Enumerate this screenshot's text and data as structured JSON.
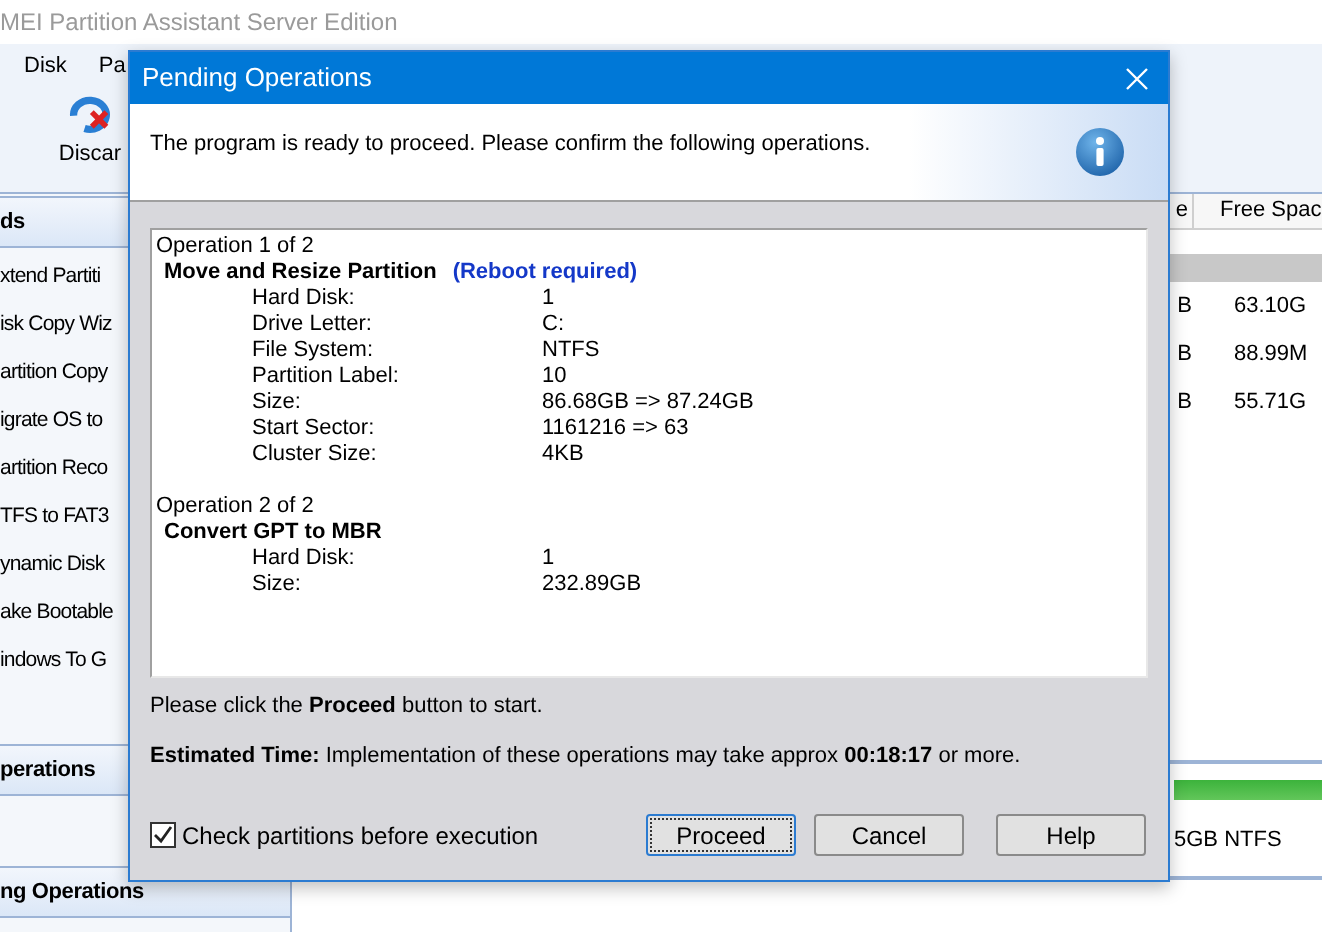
{
  "app": {
    "title": "MEI Partition Assistant Server Edition",
    "menu": [
      "Disk",
      "Pa"
    ],
    "toolbar": [
      {
        "label": "Discar"
      }
    ],
    "sidebar": {
      "sections": [
        {
          "title": "ds",
          "items": [
            "xtend Partiti",
            "isk Copy Wiz",
            "artition Copy",
            "igrate OS to",
            "artition Reco",
            "TFS to FAT3",
            "ynamic Disk",
            "ake Bootable",
            "indows To G"
          ]
        },
        {
          "title": "perations"
        },
        {
          "title": "ng Operations"
        }
      ]
    },
    "table": {
      "columns": [
        "e",
        "Free Spac"
      ],
      "rows": [
        [
          "B",
          "63.10G"
        ],
        [
          "B",
          "88.99M"
        ],
        [
          "B",
          "55.71G"
        ]
      ]
    },
    "disk_map": {
      "label": "5GB NTFS"
    }
  },
  "dialog": {
    "title": "Pending Operations",
    "intro": "The program is ready to proceed. Please confirm the following operations.",
    "operations": [
      {
        "heading": "Operation 1 of 2",
        "title": "Move and Resize Partition",
        "note": "(Reboot required)",
        "fields": [
          {
            "label": "Hard Disk:",
            "value": "1"
          },
          {
            "label": "Drive Letter:",
            "value": "C:"
          },
          {
            "label": "File System:",
            "value": "NTFS"
          },
          {
            "label": "Partition Label:",
            "value": "10"
          },
          {
            "label": "Size:",
            "value": "86.68GB => 87.24GB"
          },
          {
            "label": "Start Sector:",
            "value": "1161216 => 63"
          },
          {
            "label": "Cluster Size:",
            "value": "4KB"
          }
        ]
      },
      {
        "heading": "Operation 2 of 2",
        "title": "Convert GPT to MBR",
        "fields": [
          {
            "label": "Hard Disk:",
            "value": "1"
          },
          {
            "label": "Size:",
            "value": "232.89GB"
          }
        ]
      }
    ],
    "instruction": "Please click the **Proceed** button to start.",
    "estimate": "**Estimated Time:** Implementation of these operations may take approx **00:18:17** or more.",
    "check": {
      "label": "Check partitions before execution",
      "checked": true
    },
    "buttons": [
      {
        "label": "Proceed",
        "default": true
      },
      {
        "label": "Cancel",
        "default": false
      },
      {
        "label": "Help",
        "default": false
      }
    ]
  }
}
